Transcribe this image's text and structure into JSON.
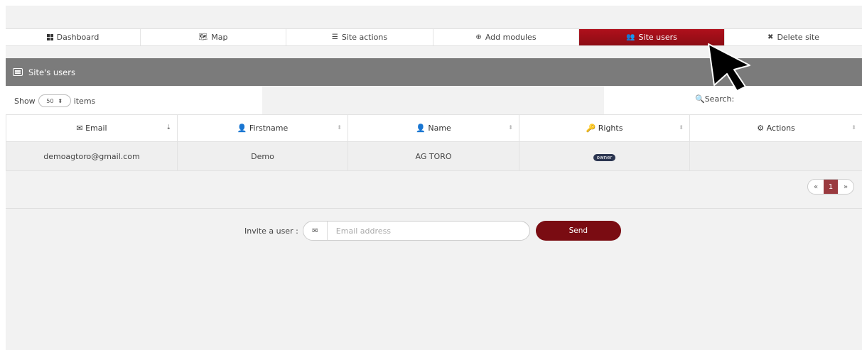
{
  "tabs": [
    {
      "label": "Dashboard",
      "icon": "grid-icon"
    },
    {
      "label": "Map",
      "icon": "map-icon"
    },
    {
      "label": "Site actions",
      "icon": "sliders-icon"
    },
    {
      "label": "Add modules",
      "icon": "plus-circle-icon"
    },
    {
      "label": "Site users",
      "icon": "users-icon",
      "active": true
    },
    {
      "label": "Delete site",
      "icon": "close-icon"
    }
  ],
  "panel": {
    "title": "Site's users",
    "show_label": "Show",
    "page_size": "50",
    "items_label": "items",
    "search_label": "Search:"
  },
  "table": {
    "columns": [
      "Email",
      "Firstname",
      "Name",
      "Rights",
      "Actions"
    ],
    "rows": [
      {
        "email": "demoagtoro@gmail.com",
        "firstname": "Demo",
        "name": "AG TORO",
        "rights": "owner",
        "actions": ""
      }
    ]
  },
  "pagination": {
    "prev": "«",
    "current": "1",
    "next": "»"
  },
  "invite": {
    "label": "Invite a user :",
    "placeholder": "Email address",
    "send_label": "Send"
  },
  "colors": {
    "accent": "#8c0c14",
    "header_gray": "#7b7b7b",
    "badge": "#2b3550"
  }
}
